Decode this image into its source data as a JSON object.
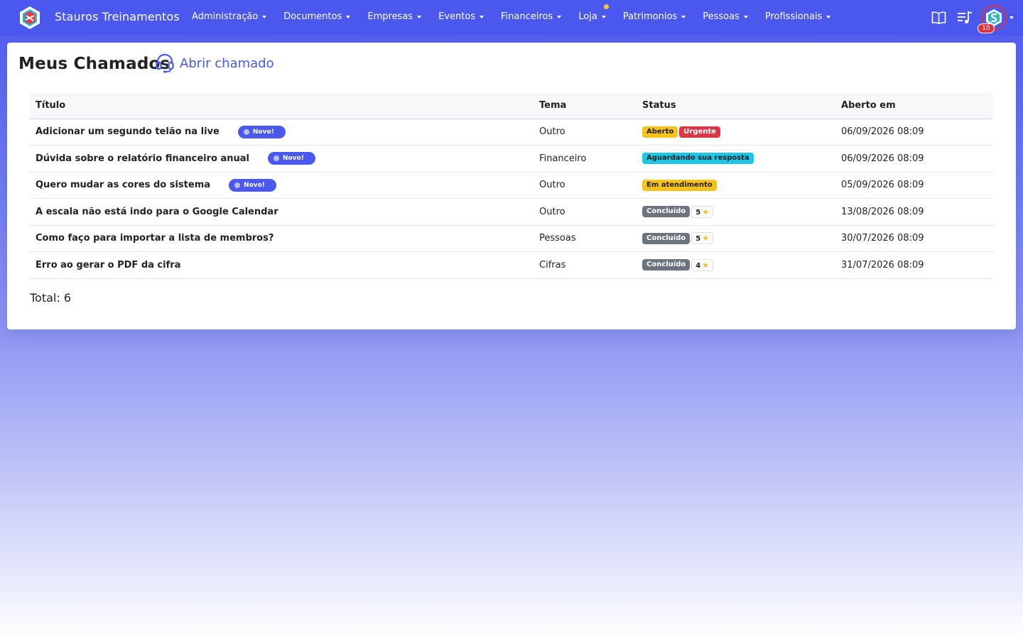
{
  "app": {
    "name": "Stauros Treinamentos",
    "logo_icon": "stauros-logo-icon"
  },
  "nav": {
    "items": [
      {
        "label": "Administração",
        "has_dot": false
      },
      {
        "label": "Documentos",
        "has_dot": false
      },
      {
        "label": "Empresas",
        "has_dot": false
      },
      {
        "label": "Eventos",
        "has_dot": false
      },
      {
        "label": "Financeiros",
        "has_dot": false
      },
      {
        "label": "Loja",
        "has_dot": true
      },
      {
        "label": "Patrimonios",
        "has_dot": false
      },
      {
        "label": "Pessoas",
        "has_dot": false
      },
      {
        "label": "Profissionais",
        "has_dot": false
      }
    ],
    "right_icons": [
      "book-open-icon",
      "music-list-icon"
    ],
    "notification_count": "10"
  },
  "page": {
    "title": "Meus Chamados",
    "open_ticket_label": "Abrir chamado",
    "open_ticket_icon": "headset-icon",
    "total_label": "Total: 6"
  },
  "table": {
    "headers": {
      "title": "Título",
      "theme": "Tema",
      "status": "Status",
      "opened": "Aberto em"
    },
    "rows": [
      {
        "title": "Adicionar um segundo telão na live",
        "is_new": true,
        "new_label": "Novo!",
        "theme": "Outro",
        "status": [
          {
            "label": "Aberto",
            "variant": "warning"
          },
          {
            "label": "Urgente",
            "variant": "danger"
          }
        ],
        "rating": null,
        "opened": "06/09/2026 08:09"
      },
      {
        "title": "Dúvida sobre o relatório financeiro anual",
        "is_new": true,
        "new_label": "Novo!",
        "theme": "Financeiro",
        "status": [
          {
            "label": "Aguardando sua resposta",
            "variant": "info"
          }
        ],
        "rating": null,
        "opened": "06/09/2026 08:09"
      },
      {
        "title": "Quero mudar as cores do sistema",
        "is_new": true,
        "new_label": "Novo!",
        "theme": "Outro",
        "status": [
          {
            "label": "Em atendimento",
            "variant": "warning"
          }
        ],
        "rating": null,
        "opened": "05/09/2026 08:09"
      },
      {
        "title": "A escala não está indo para o Google Calendar",
        "is_new": false,
        "new_label": "",
        "theme": "Outro",
        "status": [
          {
            "label": "Concluído",
            "variant": "secondary"
          }
        ],
        "rating": "5",
        "opened": "13/08/2026 08:09"
      },
      {
        "title": "Como faço para importar a lista de membros?",
        "is_new": false,
        "new_label": "",
        "theme": "Pessoas",
        "status": [
          {
            "label": "Concluído",
            "variant": "secondary"
          }
        ],
        "rating": "5",
        "opened": "30/07/2026 08:09"
      },
      {
        "title": "Erro ao gerar o PDF da cifra",
        "is_new": false,
        "new_label": "",
        "theme": "Cifras",
        "status": [
          {
            "label": "Concluído",
            "variant": "secondary"
          }
        ],
        "rating": "4",
        "opened": "31/07/2026 08:09"
      }
    ]
  },
  "colors": {
    "primary": "#4b58ee",
    "warning": "#f6c21c",
    "danger": "#dc3545",
    "info": "#1ec6e6",
    "secondary": "#6c757d"
  }
}
